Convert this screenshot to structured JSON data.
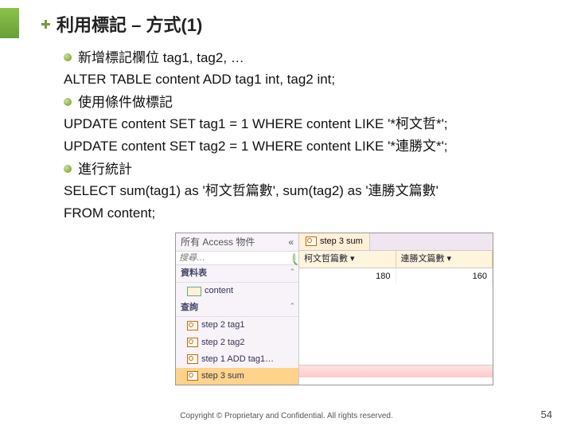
{
  "title": "利用標記 – 方式(1)",
  "bullets": {
    "b1": "新增標記欄位 tag1, tag2, …",
    "b2": "使用條件做標記",
    "b3": "進行統計"
  },
  "code": {
    "l1": "ALTER TABLE content ADD tag1 int, tag2 int;",
    "l2": "UPDATE content SET tag1 = 1 WHERE content LIKE '*柯文哲*';",
    "l3": "UPDATE content SET tag2 = 1 WHERE content LIKE '*連勝文*';",
    "l4": "SELECT sum(tag1) as '柯文哲篇數', sum(tag2) as '連勝文篇數'",
    "l5": "FROM content;"
  },
  "access": {
    "paneTitle": "所有 Access 物件",
    "collapse": "«",
    "searchPlaceholder": "搜尋…",
    "grpTables": "資料表",
    "grpQueries": "查詢",
    "items": {
      "content": "content",
      "s2t1": "step 2 tag1",
      "s2t2": "step 2 tag2",
      "s1": "step 1 ADD tag1…",
      "s3": "step 3 sum"
    },
    "tab": "step 3 sum",
    "col1": "柯文哲篇數",
    "col2": "連勝文篇數",
    "val1": "180",
    "val2": "160"
  },
  "footer": "Copyright © Proprietary and Confidential. All rights reserved.",
  "page": "54"
}
